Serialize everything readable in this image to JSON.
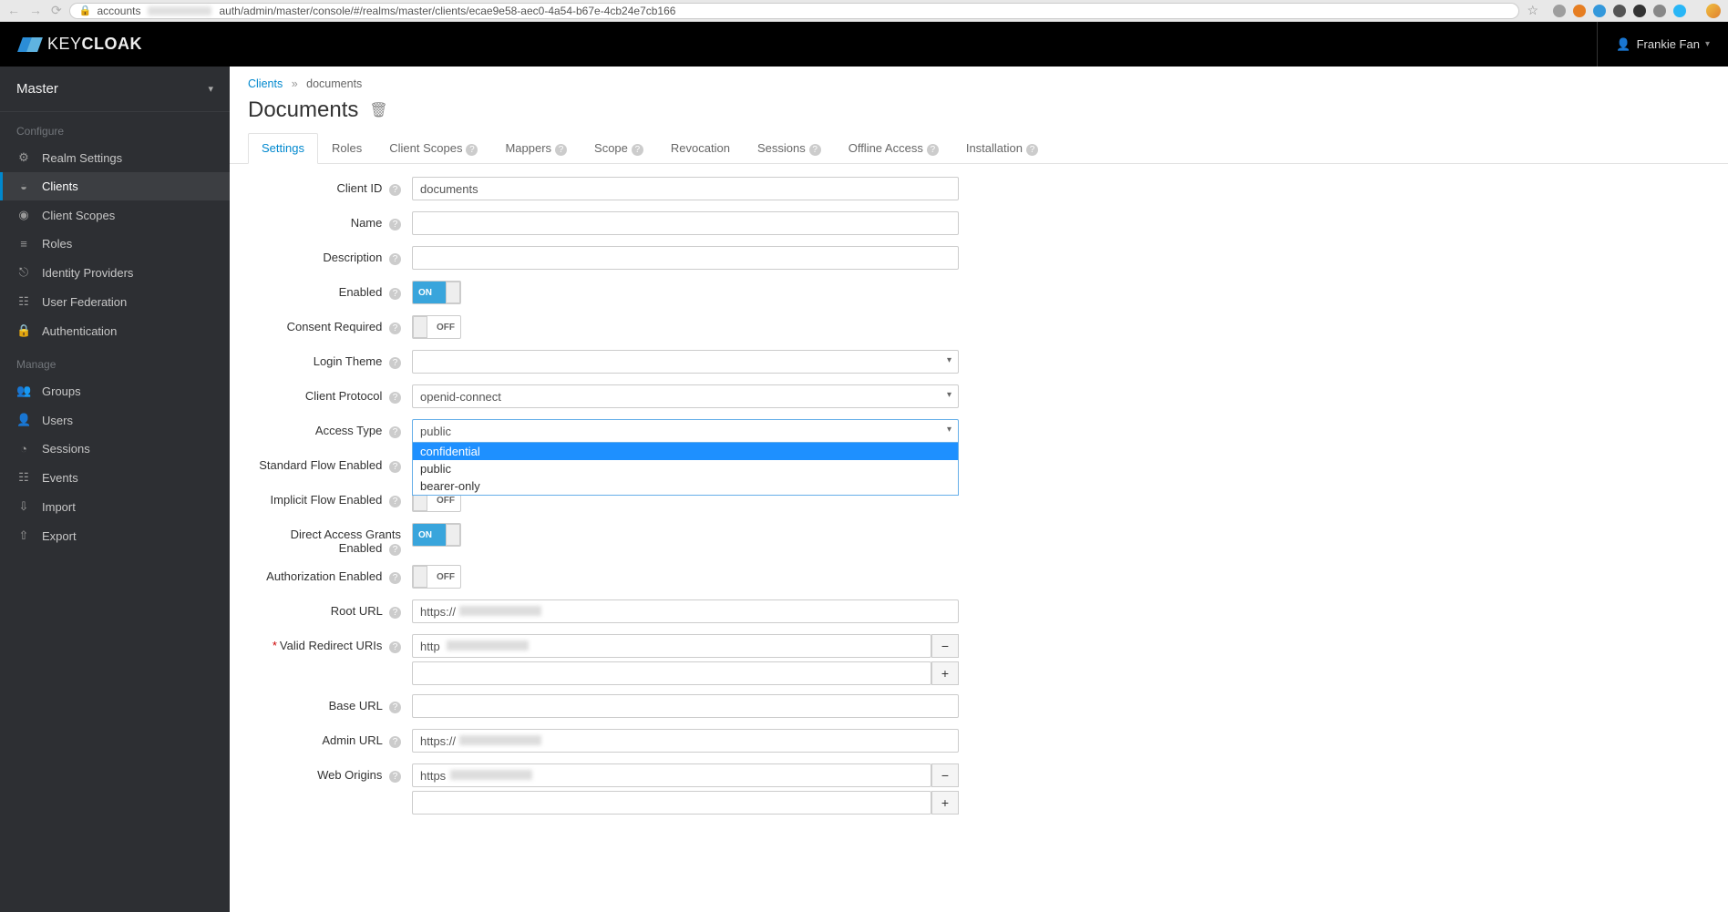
{
  "browser": {
    "url_prefix": "accounts",
    "url_suffix": "auth/admin/master/console/#/realms/master/clients/ecae9e58-aec0-4a54-b67e-4cb24e7cb166"
  },
  "logo_text_light": "KEY",
  "logo_text_bold": "CLOAK",
  "user_name": "Frankie Fan",
  "realm_selector": "Master",
  "sidebar": {
    "section_configure": "Configure",
    "section_manage": "Manage",
    "items_configure": [
      {
        "label": "Realm Settings",
        "icon": "⚙"
      },
      {
        "label": "Clients",
        "icon": "◒",
        "active": true
      },
      {
        "label": "Client Scopes",
        "icon": "◉"
      },
      {
        "label": "Roles",
        "icon": "≡"
      },
      {
        "label": "Identity Providers",
        "icon": "⎋"
      },
      {
        "label": "User Federation",
        "icon": "☷"
      },
      {
        "label": "Authentication",
        "icon": "🔒"
      }
    ],
    "items_manage": [
      {
        "label": "Groups",
        "icon": "👥"
      },
      {
        "label": "Users",
        "icon": "👤"
      },
      {
        "label": "Sessions",
        "icon": "◔"
      },
      {
        "label": "Events",
        "icon": "☷"
      },
      {
        "label": "Import",
        "icon": "⇩"
      },
      {
        "label": "Export",
        "icon": "⇧"
      }
    ]
  },
  "breadcrumb": {
    "parent": "Clients",
    "current": "documents"
  },
  "page_title": "Documents",
  "tabs": [
    {
      "label": "Settings",
      "active": true
    },
    {
      "label": "Roles"
    },
    {
      "label": "Client Scopes",
      "help": true
    },
    {
      "label": "Mappers",
      "help": true
    },
    {
      "label": "Scope",
      "help": true
    },
    {
      "label": "Revocation"
    },
    {
      "label": "Sessions",
      "help": true
    },
    {
      "label": "Offline Access",
      "help": true
    },
    {
      "label": "Installation",
      "help": true
    }
  ],
  "form": {
    "client_id": {
      "label": "Client ID",
      "value": "documents"
    },
    "name": {
      "label": "Name",
      "value": ""
    },
    "description": {
      "label": "Description",
      "value": ""
    },
    "enabled": {
      "label": "Enabled",
      "on": true
    },
    "consent_required": {
      "label": "Consent Required",
      "on": false
    },
    "login_theme": {
      "label": "Login Theme",
      "value": ""
    },
    "client_protocol": {
      "label": "Client Protocol",
      "value": "openid-connect"
    },
    "access_type": {
      "label": "Access Type",
      "value": "public",
      "options": [
        "confidential",
        "public",
        "bearer-only"
      ],
      "highlighted": "confidential"
    },
    "standard_flow": {
      "label": "Standard Flow Enabled",
      "on": true
    },
    "implicit_flow": {
      "label": "Implicit Flow Enabled",
      "on": false
    },
    "direct_access": {
      "label": "Direct Access Grants Enabled",
      "on": true
    },
    "authorization_enabled": {
      "label": "Authorization Enabled",
      "on": false
    },
    "root_url": {
      "label": "Root URL",
      "value": "https://"
    },
    "valid_redirect": {
      "label": "Valid Redirect URIs",
      "required": true,
      "value": "http"
    },
    "base_url": {
      "label": "Base URL",
      "value": ""
    },
    "admin_url": {
      "label": "Admin URL",
      "value": "https://"
    },
    "web_origins": {
      "label": "Web Origins",
      "value": "https"
    }
  },
  "toggle_on_label": "ON",
  "toggle_off_label": "OFF"
}
